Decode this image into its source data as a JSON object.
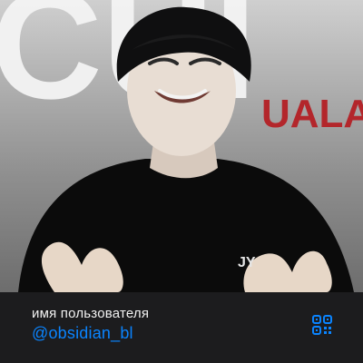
{
  "profile": {
    "field_label": "имя пользователя",
    "username": "@obsidian_bl"
  },
  "photo": {
    "backdrop_letters": "CUI",
    "backdrop_red_text": "UALA",
    "shirt_logo": "JY"
  },
  "icons": {
    "qr": "qr-code-icon"
  },
  "colors": {
    "card_bg": "#1c1c1e",
    "link": "#0a84ff",
    "label": "#f2f2f2"
  }
}
